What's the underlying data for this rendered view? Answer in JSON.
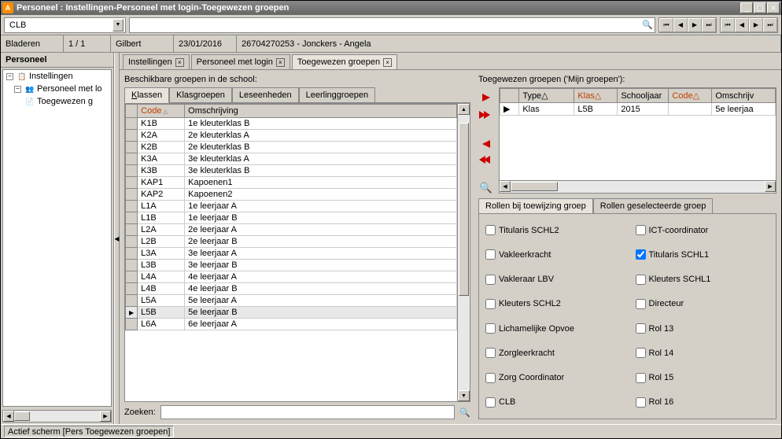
{
  "title": "Personeel : Instellingen-Personeel met login-Toegewezen groepen",
  "toolbar": {
    "dropdown_value": "CLB"
  },
  "infobar": {
    "bladeren": "Bladeren",
    "page": "1 / 1",
    "user": "Gilbert",
    "date": "23/01/2016",
    "context": "26704270253 - Jonckers - Angela"
  },
  "sidebar": {
    "title": "Personeel",
    "tree": {
      "root": "Instellingen",
      "child1": "Personeel met lo",
      "child2": "Toegewezen g"
    }
  },
  "tabs": {
    "t1": "Instellingen",
    "t2": "Personeel met login",
    "t3": "Toegewezen groepen"
  },
  "left_panel": {
    "label": "Beschikbare groepen in de school:",
    "subtabs": {
      "t1": "Klassen",
      "t2": "Klasgroepen",
      "t3": "Leseenheden",
      "t4": "Leerlinggroepen"
    },
    "headers": {
      "code": "Code",
      "oms": "Omschrijving"
    },
    "rows": [
      {
        "code": "K1B",
        "oms": "1e kleuterklas B"
      },
      {
        "code": "K2A",
        "oms": "2e kleuterklas A"
      },
      {
        "code": "K2B",
        "oms": "2e kleuterklas B"
      },
      {
        "code": "K3A",
        "oms": "3e kleuterklas A"
      },
      {
        "code": "K3B",
        "oms": "3e kleuterklas B"
      },
      {
        "code": "KAP1",
        "oms": "Kapoenen1"
      },
      {
        "code": "KAP2",
        "oms": "Kapoenen2"
      },
      {
        "code": "L1A",
        "oms": "1e leerjaar A"
      },
      {
        "code": "L1B",
        "oms": "1e leerjaar B"
      },
      {
        "code": "L2A",
        "oms": "2e leerjaar A"
      },
      {
        "code": "L2B",
        "oms": "2e leerjaar B"
      },
      {
        "code": "L3A",
        "oms": "3e leerjaar A"
      },
      {
        "code": "L3B",
        "oms": "3e leerjaar B"
      },
      {
        "code": "L4A",
        "oms": "4e leerjaar A"
      },
      {
        "code": "L4B",
        "oms": "4e leerjaar B"
      },
      {
        "code": "L5A",
        "oms": "5e leerjaar A"
      },
      {
        "code": "L5B",
        "oms": "5e leerjaar B"
      },
      {
        "code": "L6A",
        "oms": "6e leerjaar A"
      }
    ],
    "selected_index": 16,
    "search_label": "Zoeken:"
  },
  "right_panel": {
    "label": "Toegewezen groepen ('Mijn groepen'):",
    "headers": {
      "type": "Type",
      "klas": "Klas",
      "schooljaar": "Schooljaar",
      "code": "Code",
      "oms": "Omschrijv"
    },
    "rows": [
      {
        "type": "Klas",
        "klas": "L5B",
        "schooljaar": "2015",
        "code": "",
        "oms": "5e leerjaa"
      }
    ],
    "roles_tabs": {
      "t1": "Rollen bij toewijzing groep",
      "t2": "Rollen geselecteerde groep"
    },
    "roles": [
      {
        "label": "Titularis SCHL2",
        "chk": false
      },
      {
        "label": "ICT-coordinator",
        "chk": false
      },
      {
        "label": "Vakleerkracht",
        "chk": false
      },
      {
        "label": "Titularis SCHL1",
        "chk": true
      },
      {
        "label": "Vakleraar LBV",
        "chk": false
      },
      {
        "label": "Kleuters SCHL1",
        "chk": false
      },
      {
        "label": "Kleuters SCHL2",
        "chk": false
      },
      {
        "label": "Directeur",
        "chk": false
      },
      {
        "label": "Lichamelijke Opvoe",
        "chk": false
      },
      {
        "label": "Rol 13",
        "chk": false
      },
      {
        "label": "Zorgleerkracht",
        "chk": false
      },
      {
        "label": "Rol 14",
        "chk": false
      },
      {
        "label": "Zorg Coordinator",
        "chk": false
      },
      {
        "label": "Rol 15",
        "chk": false
      },
      {
        "label": "CLB",
        "chk": false
      },
      {
        "label": "Rol 16",
        "chk": false
      }
    ]
  },
  "statusbar": {
    "text": "Actief scherm [Pers Toegewezen groepen]"
  }
}
